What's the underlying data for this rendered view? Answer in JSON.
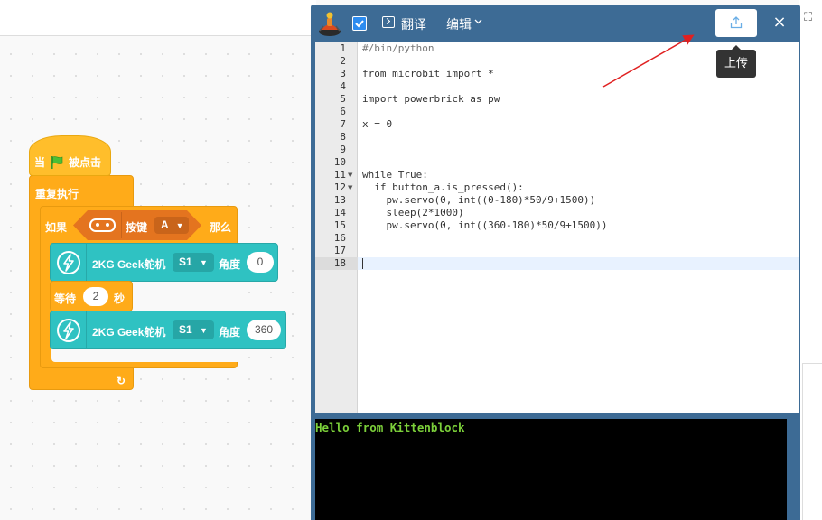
{
  "blocks": {
    "hat": {
      "prefix": "当",
      "suffix": "被点击"
    },
    "forever_label": "重复执行",
    "if": {
      "if_label": "如果",
      "then_label": "那么",
      "button_label": "按键",
      "button_value": "A"
    },
    "servo1": {
      "label": "2KG Geek舵机",
      "port": "S1",
      "angle_label": "角度",
      "angle_value": "0"
    },
    "wait": {
      "label": "等待",
      "value": "2",
      "unit": "秒"
    },
    "servo2": {
      "label": "2KG Geek舵机",
      "port": "S1",
      "angle_label": "角度",
      "angle_value": "360"
    }
  },
  "editor": {
    "translate_label": "翻译",
    "edit_menu_label": "编辑",
    "close_symbol": "×",
    "tooltip": "上传",
    "code_lines": [
      "#/bin/python",
      "",
      "from microbit import *",
      "",
      "import powerbrick as pw",
      "",
      "x = 0",
      "",
      "",
      "",
      "while True:",
      "  if button_a.is_pressed():",
      "    pw.servo(0, int((0-180)*50/9+1500))",
      "    sleep(2*1000)",
      "    pw.servo(0, int((360-180)*50/9+1500))",
      "",
      "",
      ""
    ],
    "line_numbers": [
      "1",
      "2",
      "3",
      "4",
      "5",
      "6",
      "7",
      "8",
      "9",
      "10",
      "11",
      "12",
      "13",
      "14",
      "15",
      "16",
      "17",
      "18"
    ],
    "console_output": "Hello from Kittenblock"
  },
  "colors": {
    "event": "#ffbe2b",
    "control": "#ffab19",
    "sensor": "#e4741f",
    "servo": "#2fc2c2",
    "window": "#3d6b95",
    "console_text": "#7cd03a",
    "annotation": "#e02020"
  }
}
